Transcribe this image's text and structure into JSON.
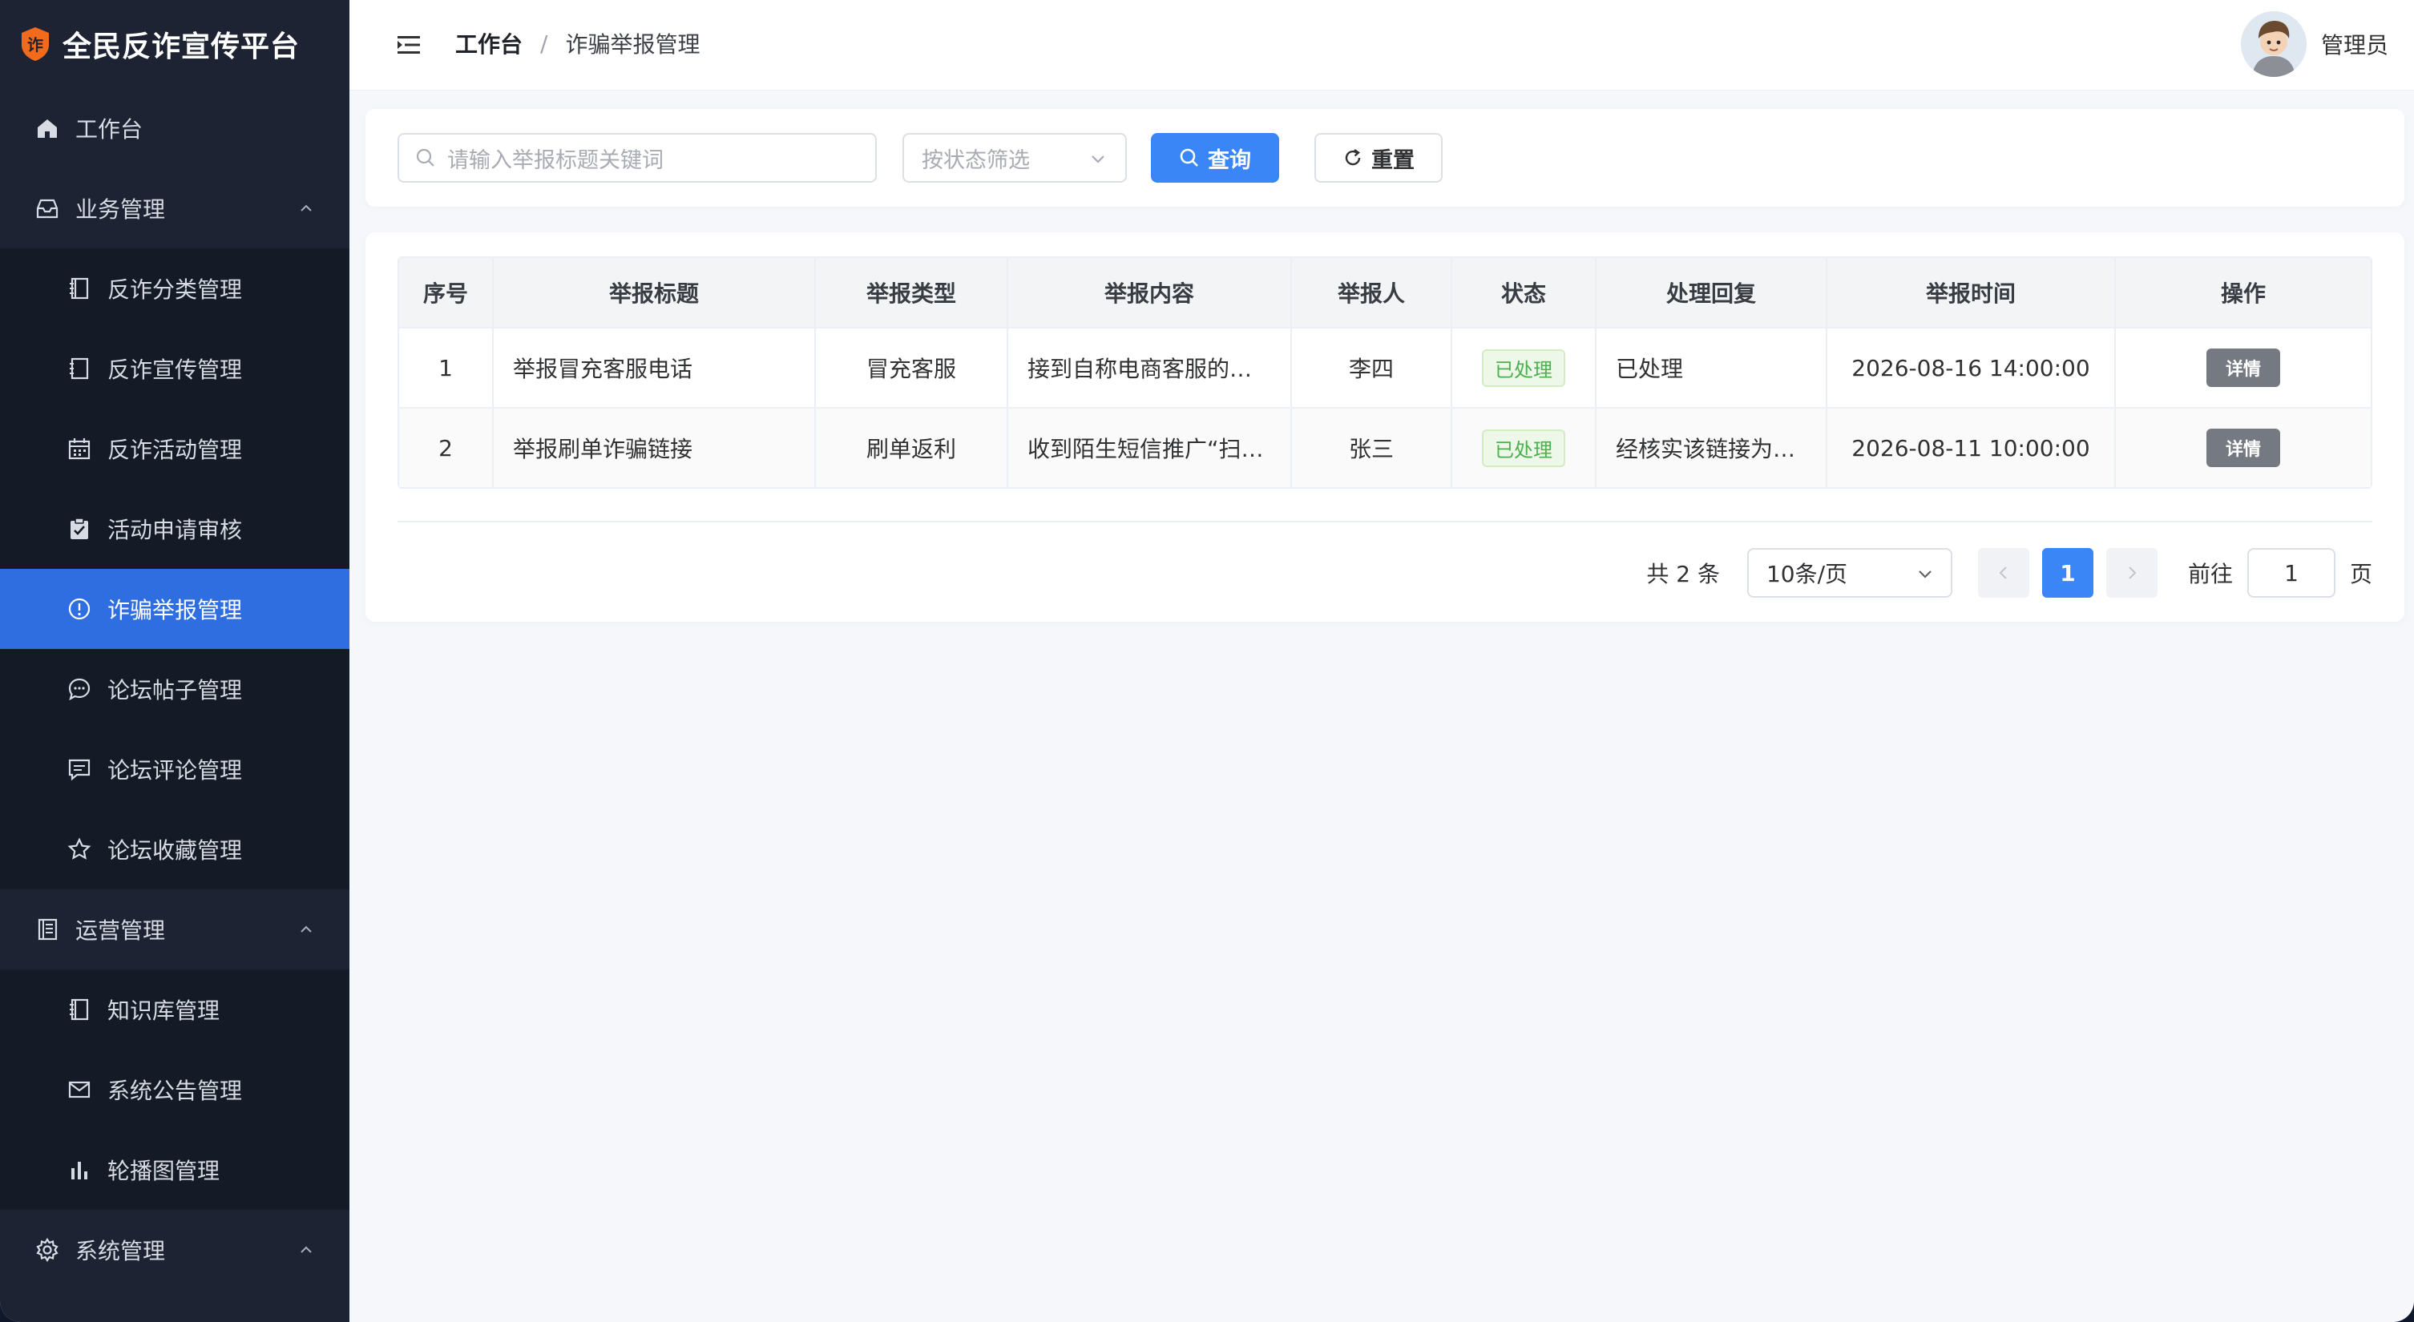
{
  "brand": {
    "title": "全民反诈宣传平台",
    "logo_char": "诈",
    "logo_color": "#f26b1d"
  },
  "sidebar": {
    "items": [
      {
        "label": "工作台",
        "icon": "home-icon",
        "level": "top"
      },
      {
        "label": "业务管理",
        "icon": "inbox-icon",
        "level": "top",
        "expanded": true
      },
      {
        "label": "反诈分类管理",
        "icon": "notebook-icon",
        "level": "sub"
      },
      {
        "label": "反诈宣传管理",
        "icon": "document-icon",
        "level": "sub"
      },
      {
        "label": "反诈活动管理",
        "icon": "calendar-icon",
        "level": "sub"
      },
      {
        "label": "活动申请审核",
        "icon": "clipboard-check-icon",
        "level": "sub"
      },
      {
        "label": "诈骗举报管理",
        "icon": "warning-circle-icon",
        "level": "sub",
        "active": true
      },
      {
        "label": "论坛帖子管理",
        "icon": "chat-bubble-icon",
        "level": "sub"
      },
      {
        "label": "论坛评论管理",
        "icon": "comment-icon",
        "level": "sub"
      },
      {
        "label": "论坛收藏管理",
        "icon": "star-icon",
        "level": "sub"
      },
      {
        "label": "运营管理",
        "icon": "tickets-icon",
        "level": "top",
        "expanded": true
      },
      {
        "label": "知识库管理",
        "icon": "notebook-icon",
        "level": "sub"
      },
      {
        "label": "系统公告管理",
        "icon": "message-icon",
        "level": "sub"
      },
      {
        "label": "轮播图管理",
        "icon": "bar-chart-icon",
        "level": "sub"
      },
      {
        "label": "系统管理",
        "icon": "gear-icon",
        "level": "top",
        "expanded": true
      }
    ],
    "active_color": "#2f6ee0"
  },
  "header": {
    "breadcrumb_home": "工作台",
    "breadcrumb_separator": "/",
    "breadcrumb_current": "诈骗举报管理",
    "user_name": "管理员"
  },
  "filter": {
    "search_placeholder": "请输入举报标题关键词",
    "status_placeholder": "按状态筛选",
    "query_label": "查询",
    "reset_label": "重置",
    "query_color": "#3a86f7"
  },
  "table": {
    "columns": [
      "序号",
      "举报标题",
      "举报类型",
      "举报内容",
      "举报人",
      "状态",
      "处理回复",
      "举报时间",
      "操作"
    ],
    "rows": [
      {
        "index": "1",
        "title": "举报冒充客服电话",
        "type": "冒充客服",
        "content": "接到自称电商客服的…",
        "reporter": "李四",
        "status": "已处理",
        "reply": "已处理",
        "time": "2026-08-16 14:00:00",
        "action": "详情"
      },
      {
        "index": "2",
        "title": "举报刷单诈骗链接",
        "type": "刷单返利",
        "content": "收到陌生短信推广“扫…",
        "reporter": "张三",
        "status": "已处理",
        "reply": "经核实该链接为…",
        "time": "2026-08-11 10:00:00",
        "action": "详情"
      }
    ]
  },
  "pagination": {
    "total_text": "共 2 条",
    "page_size": "10条/页",
    "current_page": "1",
    "goto_label": "前往",
    "goto_value": "1",
    "page_suffix": "页"
  }
}
